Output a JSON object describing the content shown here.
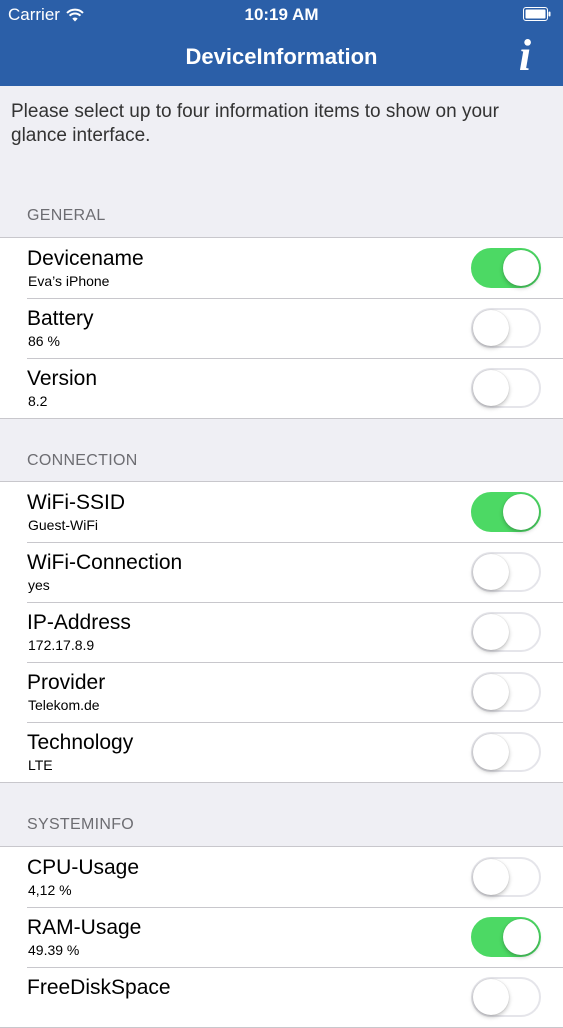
{
  "status_bar": {
    "carrier": "Carrier",
    "time": "10:19 AM"
  },
  "nav": {
    "title": "DeviceInformation",
    "info_label": "i"
  },
  "intro": "Please select up to four information items to show on your glance interface.",
  "sections": [
    {
      "header": "GENERAL",
      "items": [
        {
          "title": "Devicename",
          "value": "Eva’s iPhone",
          "on": true
        },
        {
          "title": "Battery",
          "value": "86 %",
          "on": false
        },
        {
          "title": "Version",
          "value": "8.2",
          "on": false
        }
      ]
    },
    {
      "header": "CONNECTION",
      "items": [
        {
          "title": "WiFi-SSID",
          "value": "Guest-WiFi",
          "on": true
        },
        {
          "title": "WiFi-Connection",
          "value": "yes",
          "on": false
        },
        {
          "title": "IP-Address",
          "value": "172.17.8.9",
          "on": false
        },
        {
          "title": "Provider",
          "value": "Telekom.de",
          "on": false
        },
        {
          "title": "Technology",
          "value": "LTE",
          "on": false
        }
      ]
    },
    {
      "header": "SYSTEMINFO",
      "items": [
        {
          "title": "CPU-Usage",
          "value": "4,12 %",
          "on": false
        },
        {
          "title": "RAM-Usage",
          "value": "49.39 %",
          "on": true
        },
        {
          "title": "FreeDiskSpace",
          "value": "",
          "on": false
        }
      ]
    }
  ],
  "colors": {
    "nav_bar": "#2b5fa8",
    "toggle_on": "#4cd964",
    "background": "#efeff4"
  }
}
